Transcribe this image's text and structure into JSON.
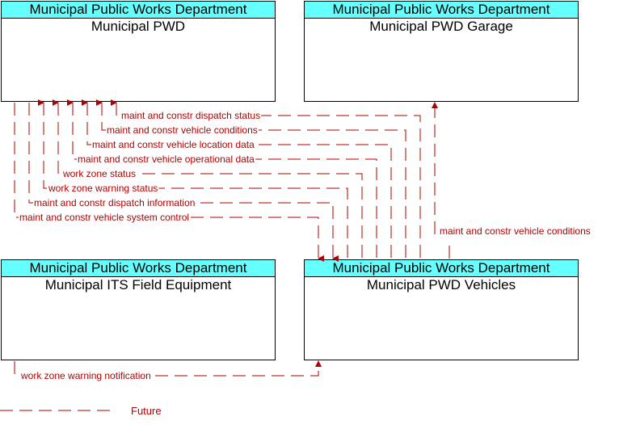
{
  "colors": {
    "flow": "#b20000",
    "header_fill": "#66ffff",
    "border": "#000000"
  },
  "elements": {
    "pwd": {
      "header": "Municipal Public Works Department",
      "title": "Municipal PWD"
    },
    "garage": {
      "header": "Municipal Public Works Department",
      "title": "Municipal PWD Garage"
    },
    "field_equipment": {
      "header": "Municipal Public Works Department",
      "title": "Municipal ITS Field Equipment"
    },
    "vehicles": {
      "header": "Municipal Public Works Department",
      "title": "Municipal PWD Vehicles"
    }
  },
  "flows": [
    {
      "label": "maint and constr dispatch status",
      "from": "Municipal PWD Vehicles",
      "to": "Municipal PWD",
      "status": "Future"
    },
    {
      "label": "maint and constr vehicle conditions",
      "from": "Municipal PWD Vehicles",
      "to": "Municipal PWD",
      "status": "Future"
    },
    {
      "label": "maint and constr vehicle location data",
      "from": "Municipal PWD Vehicles",
      "to": "Municipal PWD",
      "status": "Future"
    },
    {
      "label": "maint and constr vehicle operational data",
      "from": "Municipal PWD Vehicles",
      "to": "Municipal PWD",
      "status": "Future"
    },
    {
      "label": "work zone status",
      "from": "Municipal PWD Vehicles",
      "to": "Municipal PWD",
      "status": "Future"
    },
    {
      "label": "work zone warning status",
      "from": "Municipal PWD Vehicles",
      "to": "Municipal PWD",
      "status": "Future"
    },
    {
      "label": "maint and constr dispatch information",
      "from": "Municipal PWD",
      "to": "Municipal PWD Vehicles",
      "status": "Future"
    },
    {
      "label": "maint and constr vehicle system control",
      "from": "Municipal PWD",
      "to": "Municipal PWD Vehicles",
      "status": "Future"
    },
    {
      "label": "maint and constr vehicle conditions",
      "from": "Municipal PWD Vehicles",
      "to": "Municipal PWD Garage",
      "status": "Future"
    },
    {
      "label": "work zone warning notification",
      "from": "Municipal ITS Field Equipment",
      "to": "Municipal PWD Vehicles",
      "status": "Future"
    }
  ],
  "legend": {
    "label": "Future"
  }
}
